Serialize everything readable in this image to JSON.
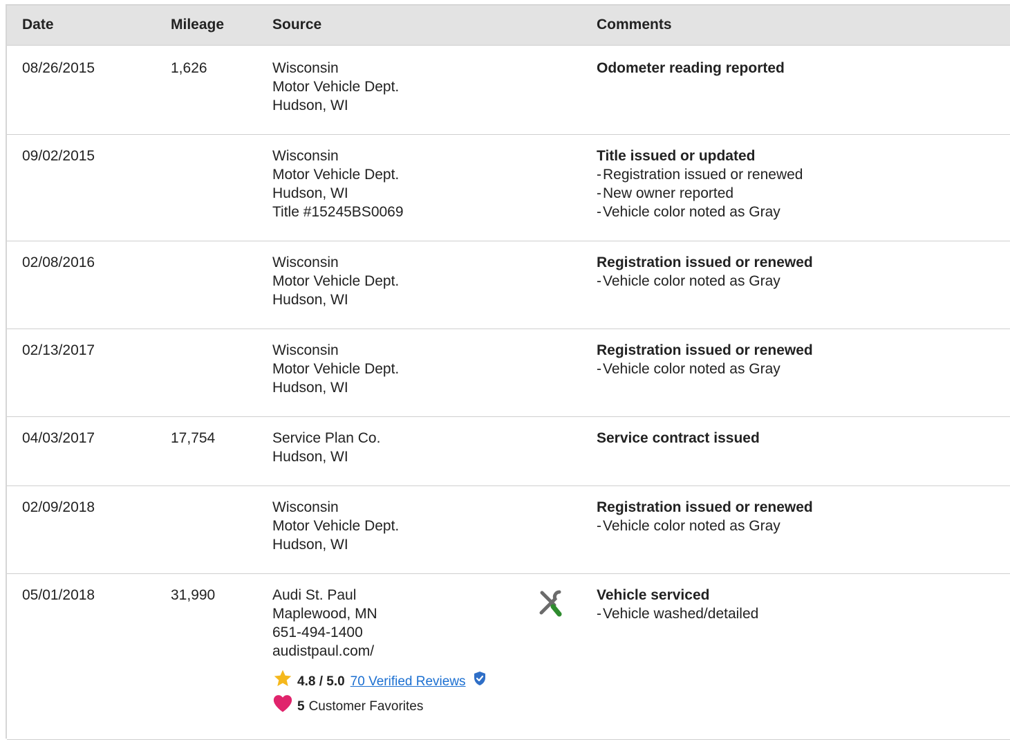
{
  "headers": {
    "date": "Date",
    "mileage": "Mileage",
    "source": "Source",
    "comments": "Comments"
  },
  "rows": [
    {
      "date": "08/26/2015",
      "mileage": "1,626",
      "source": [
        "Wisconsin",
        "Motor Vehicle Dept.",
        "Hudson, WI"
      ],
      "comment_title": "Odometer reading reported",
      "comment_items": []
    },
    {
      "date": "09/02/2015",
      "mileage": "",
      "source": [
        "Wisconsin",
        "Motor Vehicle Dept.",
        "Hudson, WI",
        "Title #15245BS0069"
      ],
      "comment_title": "Title issued or updated",
      "comment_items": [
        "Registration issued or renewed",
        "New owner reported",
        "Vehicle color noted as Gray"
      ]
    },
    {
      "date": "02/08/2016",
      "mileage": "",
      "source": [
        "Wisconsin",
        "Motor Vehicle Dept.",
        "Hudson, WI"
      ],
      "comment_title": "Registration issued or renewed",
      "comment_items": [
        "Vehicle color noted as Gray"
      ]
    },
    {
      "date": "02/13/2017",
      "mileage": "",
      "source": [
        "Wisconsin",
        "Motor Vehicle Dept.",
        "Hudson, WI"
      ],
      "comment_title": "Registration issued or renewed",
      "comment_items": [
        "Vehicle color noted as Gray"
      ]
    },
    {
      "date": "04/03/2017",
      "mileage": "17,754",
      "source": [
        "Service Plan Co.",
        "Hudson, WI"
      ],
      "comment_title": "Service contract issued",
      "comment_items": []
    },
    {
      "date": "02/09/2018",
      "mileage": "",
      "source": [
        "Wisconsin",
        "Motor Vehicle Dept.",
        "Hudson, WI"
      ],
      "comment_title": "Registration issued or renewed",
      "comment_items": [
        "Vehicle color noted as Gray"
      ]
    },
    {
      "date": "05/01/2018",
      "mileage": "31,990",
      "source": [
        "Audi St. Paul",
        "Maplewood, MN",
        "651-494-1400",
        "audistpaul.com/"
      ],
      "comment_title": "Vehicle serviced",
      "comment_items": [
        "Vehicle washed/detailed"
      ],
      "icon": "service-tools-icon",
      "rating": "4.8 / 5.0",
      "reviews_link": "70 Verified Reviews",
      "favorites_count": "5",
      "favorites_label": "Customer Favorites"
    }
  ],
  "colors": {
    "link": "#1b6fd1",
    "star": "#f5b81c",
    "heart": "#e0246c",
    "verified": "#2f6fc7",
    "wrench_green": "#2e8b2e",
    "tool_gray": "#6b6b6b"
  }
}
